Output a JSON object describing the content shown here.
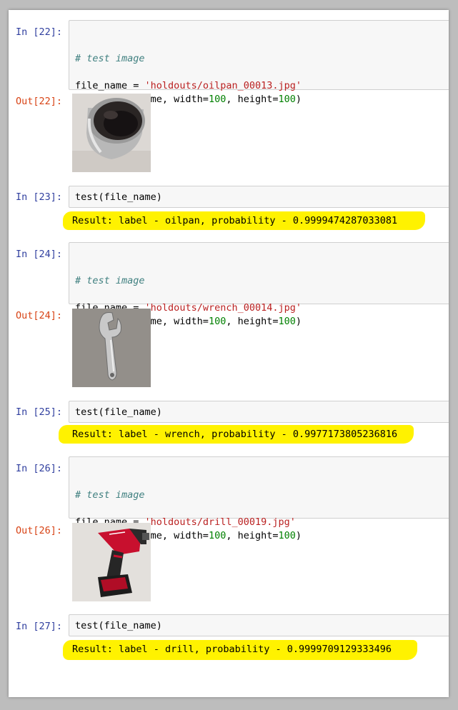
{
  "cells": [
    {
      "in_prompt": "In [22]:",
      "code": {
        "comment": "# test image",
        "line2_a": "file_name = ",
        "line2_str": "'holdouts/oilpan_00013.jpg'",
        "line3_a": "Image(file_name, width=",
        "line3_n1": "100",
        "line3_b": ", height=",
        "line3_n2": "100",
        "line3_c": ")"
      },
      "out_prompt": "Out[22]:",
      "image_subject": "oilpan"
    },
    {
      "in_prompt": "In [23]:",
      "code_line": "test(file_name)",
      "result": "Result: label - oilpan, probability - 0.9999474287033081"
    },
    {
      "in_prompt": "In [24]:",
      "code": {
        "comment": "# test image",
        "line2_a": "file_name = ",
        "line2_str": "'holdouts/wrench_00014.jpg'",
        "line3_a": "Image(file_name, width=",
        "line3_n1": "100",
        "line3_b": ", height=",
        "line3_n2": "100",
        "line3_c": ")"
      },
      "out_prompt": "Out[24]:",
      "image_subject": "wrench"
    },
    {
      "in_prompt": "In [25]:",
      "code_line": "test(file_name)",
      "result": "Result: label - wrench, probability - 0.9977173805236816"
    },
    {
      "in_prompt": "In [26]:",
      "code": {
        "comment": "# test image",
        "line2_a": "file_name = ",
        "line2_str": "'holdouts/drill_00019.jpg'",
        "line3_a": "Image(file_name, width=",
        "line3_n1": "100",
        "line3_b": ", height=",
        "line3_n2": "100",
        "line3_c": ")"
      },
      "out_prompt": "Out[26]:",
      "image_subject": "drill"
    },
    {
      "in_prompt": "In [27]:",
      "code_line": "test(file_name)",
      "result": "Result: label - drill, probability - 0.9999709129333496"
    }
  ],
  "colors": {
    "highlight": "#fff200",
    "in_prompt": "#303f9f",
    "out_prompt": "#d84315",
    "string": "#ba2121",
    "number": "#008000",
    "comment": "#408080"
  }
}
